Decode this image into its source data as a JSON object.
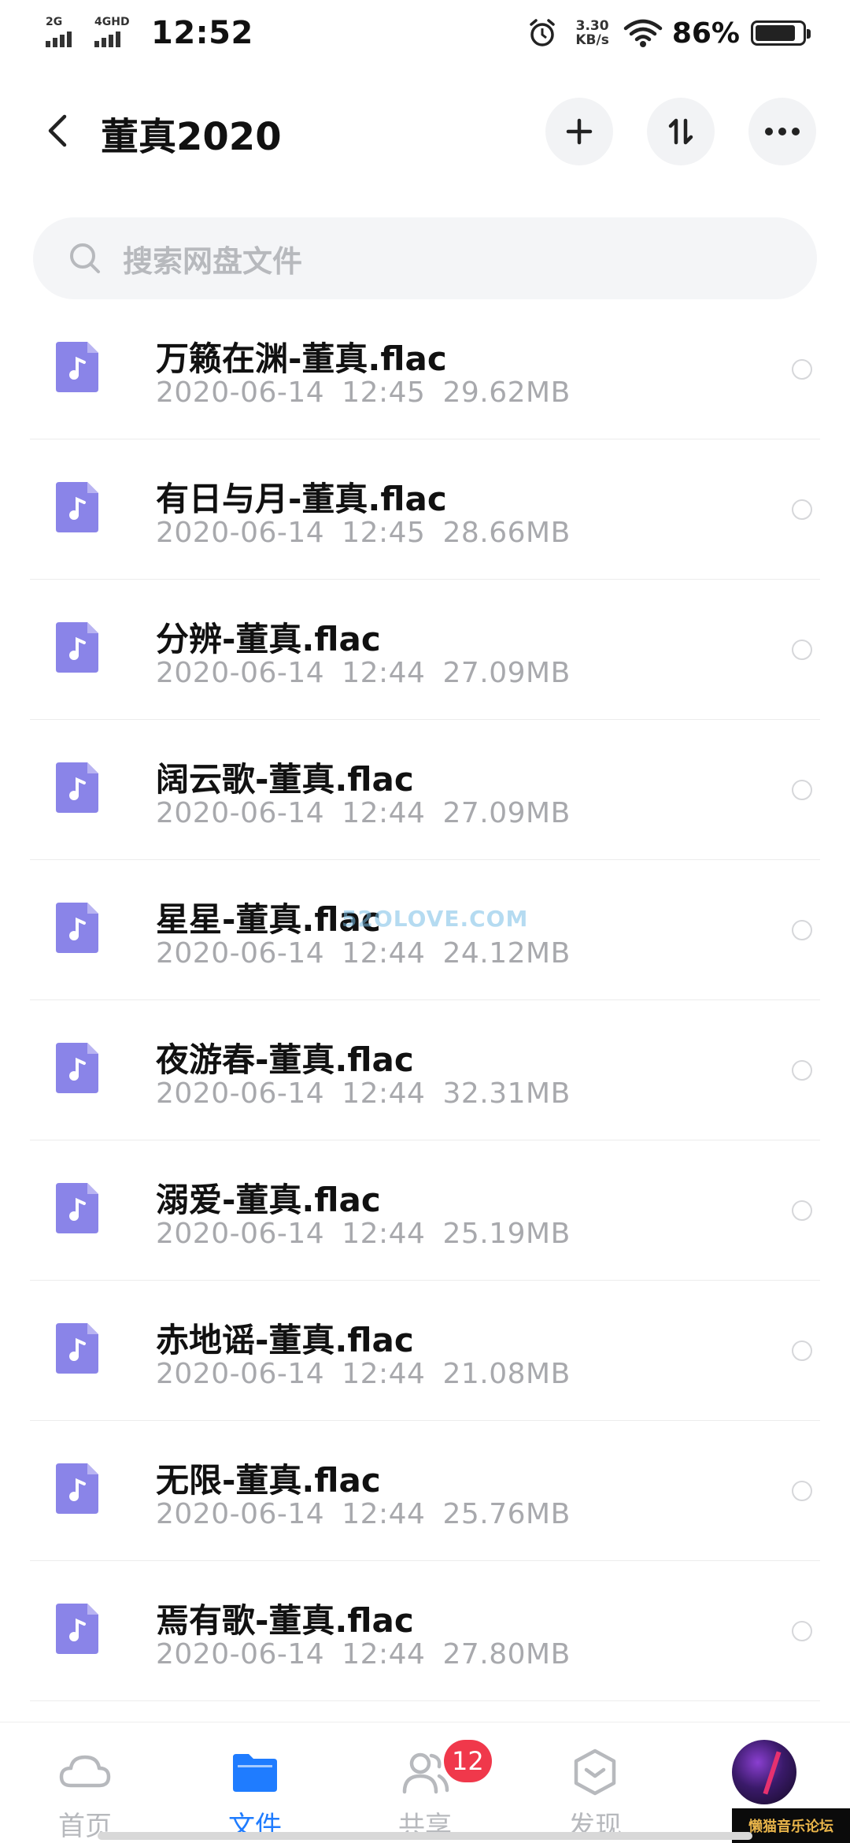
{
  "status_bar": {
    "net1_label": "2G",
    "net2_label": "4GHD",
    "time": "12:52",
    "speed_value": "3.30",
    "speed_unit": "KB/s",
    "battery_percent": "86%",
    "battery_level": 0.86
  },
  "header": {
    "title": "董真2020"
  },
  "search": {
    "placeholder": "搜索网盘文件"
  },
  "files": [
    {
      "name": "万籁在渊-董真.flac",
      "date": "2020-06-14",
      "time": "12:45",
      "size": "29.62MB"
    },
    {
      "name": "有日与月-董真.flac",
      "date": "2020-06-14",
      "time": "12:45",
      "size": "28.66MB"
    },
    {
      "name": "分辨-董真.flac",
      "date": "2020-06-14",
      "time": "12:44",
      "size": "27.09MB"
    },
    {
      "name": "阔云歌-董真.flac",
      "date": "2020-06-14",
      "time": "12:44",
      "size": "27.09MB"
    },
    {
      "name": "星星-董真.flac",
      "date": "2020-06-14",
      "time": "12:44",
      "size": "24.12MB"
    },
    {
      "name": "夜游春-董真.flac",
      "date": "2020-06-14",
      "time": "12:44",
      "size": "32.31MB"
    },
    {
      "name": "溺爱-董真.flac",
      "date": "2020-06-14",
      "time": "12:44",
      "size": "25.19MB"
    },
    {
      "name": "赤地谣-董真.flac",
      "date": "2020-06-14",
      "time": "12:44",
      "size": "21.08MB"
    },
    {
      "name": "无限-董真.flac",
      "date": "2020-06-14",
      "time": "12:44",
      "size": "25.76MB"
    },
    {
      "name": "焉有歌-董真.flac",
      "date": "2020-06-14",
      "time": "12:44",
      "size": "27.80MB"
    }
  ],
  "watermark": "52OLOVE.COM",
  "bottom_nav": {
    "home": "首页",
    "file": "文件",
    "share": "共享",
    "share_badge": "12",
    "discover": "发现"
  },
  "corner_stamp": "懒猫音乐论坛",
  "colors": {
    "accent": "#1f7cff",
    "file_icon": "#8a84e8",
    "badge": "#f0384b"
  }
}
